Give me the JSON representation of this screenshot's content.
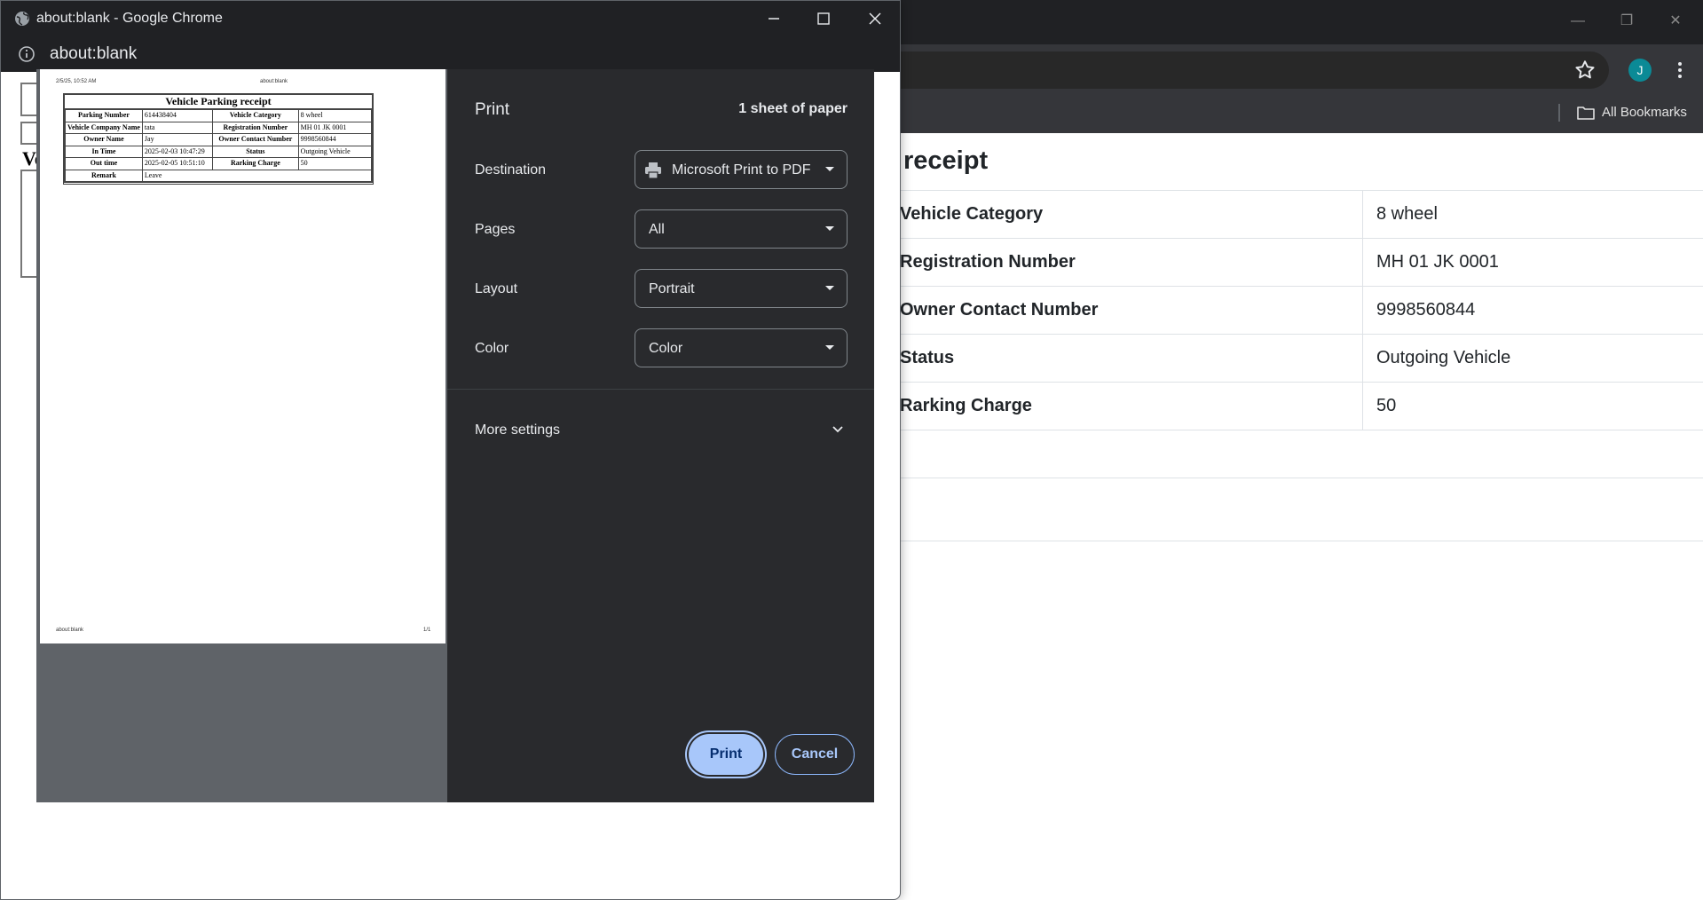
{
  "background_window": {
    "bookmarks_label": "All Bookmarks",
    "avatar_letter": "J",
    "page_heading": "receipt",
    "rows": [
      {
        "key": "Vehicle Category",
        "value": "8 wheel"
      },
      {
        "key": "Registration Number",
        "value": "MH 01 JK 0001"
      },
      {
        "key": "Owner Contact Number",
        "value": "9998560844"
      },
      {
        "key": "Status",
        "value": "Outgoing Vehicle"
      },
      {
        "key": "Rarking Charge",
        "value": "50"
      }
    ]
  },
  "popup": {
    "title": "about:blank - Google Chrome",
    "url": "about:blank",
    "underlying_fragment": "Ve"
  },
  "preview": {
    "header_date": "2/5/25, 10:52 AM",
    "header_url": "about:blank",
    "footer_url": "about:blank",
    "footer_page": "1/1",
    "receipt_title": "Vehicle Parking receipt",
    "rows": [
      [
        "Parking Number",
        "614438404",
        "Vehicle Category",
        "8 wheel"
      ],
      [
        "Vehicle Company Name",
        "tata",
        "Registration Number",
        "MH 01 JK 0001"
      ],
      [
        "Owner Name",
        "Jay",
        "Owner Contact Number",
        "9998560844"
      ],
      [
        "In Time",
        "2025-02-03 10:47:29",
        "Status",
        "Outgoing Vehicle"
      ],
      [
        "Out time",
        "2025-02-05 10:51:10",
        "Rarking Charge",
        "50"
      ]
    ],
    "remark_label": "Remark",
    "remark_value": "Leave"
  },
  "print_settings": {
    "title": "Print",
    "sheets": "1 sheet of paper",
    "destination_label": "Destination",
    "destination_value": "Microsoft Print to PDF",
    "pages_label": "Pages",
    "pages_value": "All",
    "layout_label": "Layout",
    "layout_value": "Portrait",
    "color_label": "Color",
    "color_value": "Color",
    "more_settings": "More settings",
    "print_button": "Print",
    "cancel_button": "Cancel"
  },
  "colors": {
    "dialog_bg": "#292a2d",
    "accent": "#a8c7fa",
    "avatar": "#0b8a96"
  }
}
